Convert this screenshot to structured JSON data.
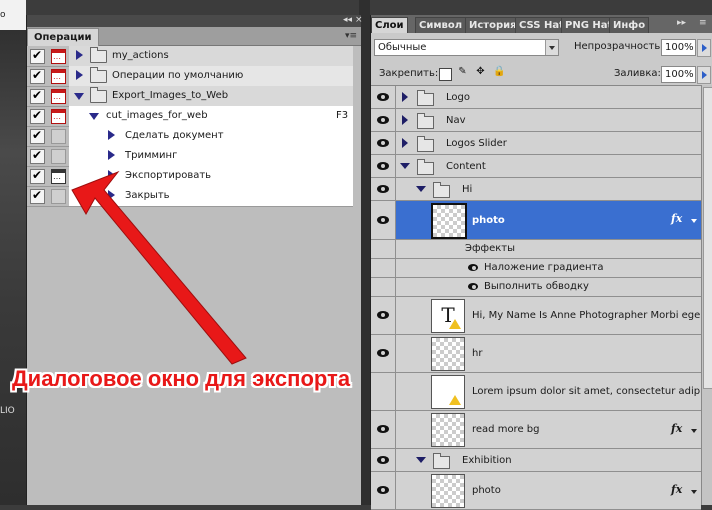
{
  "background": {
    "corner_text": "o",
    "folio_text": "LIO"
  },
  "actions_panel": {
    "tab": "Операции",
    "rows": [
      {
        "label": "my_actions",
        "dialog": "red",
        "kind": "set"
      },
      {
        "label": "Операции по умолчанию",
        "dialog": "red",
        "kind": "set"
      },
      {
        "label": "Export_Images_to_Web",
        "dialog": "red",
        "kind": "set-open"
      },
      {
        "label": "cut_images_for_web",
        "dialog": "red",
        "kind": "action-open",
        "shortcut": "F3"
      },
      {
        "label": "Сделать документ",
        "dialog": "none",
        "kind": "step"
      },
      {
        "label": "Тримминг",
        "dialog": "none",
        "kind": "step"
      },
      {
        "label": "Экспортировать",
        "dialog": "black",
        "kind": "step"
      },
      {
        "label": "Закрыть",
        "dialog": "none",
        "kind": "step"
      }
    ]
  },
  "layers_panel": {
    "tabs": [
      "Слои",
      "Символ",
      "История",
      "CSS Hat",
      "PNG Hat",
      "Инфо"
    ],
    "blend_mode": "Обычные",
    "opacity_label": "Непрозрачность:",
    "opacity_value": "100%",
    "lock_label": "Закрепить:",
    "fill_label": "Заливка:",
    "fill_value": "100%",
    "layers": [
      {
        "name": "Logo"
      },
      {
        "name": "Nav"
      },
      {
        "name": "Logos Slider"
      },
      {
        "name": "Content"
      },
      {
        "name": "Hi"
      },
      {
        "name": "photo"
      },
      {
        "name": "Эффекты"
      },
      {
        "name": "Наложение градиента"
      },
      {
        "name": "Выполнить обводку"
      },
      {
        "name": "Hi, My Name Is Anne Photographer Morbi ege..."
      },
      {
        "name": "hr"
      },
      {
        "name": "Lorem ipsum dolor sit amet, consectetur adipis..."
      },
      {
        "name": "read more bg"
      },
      {
        "name": "Exhibition"
      },
      {
        "name": "photo"
      }
    ],
    "fx_label": "fx"
  },
  "annotation": {
    "caption": "Диалоговое окно для экспорта",
    "color": "#e81818"
  }
}
